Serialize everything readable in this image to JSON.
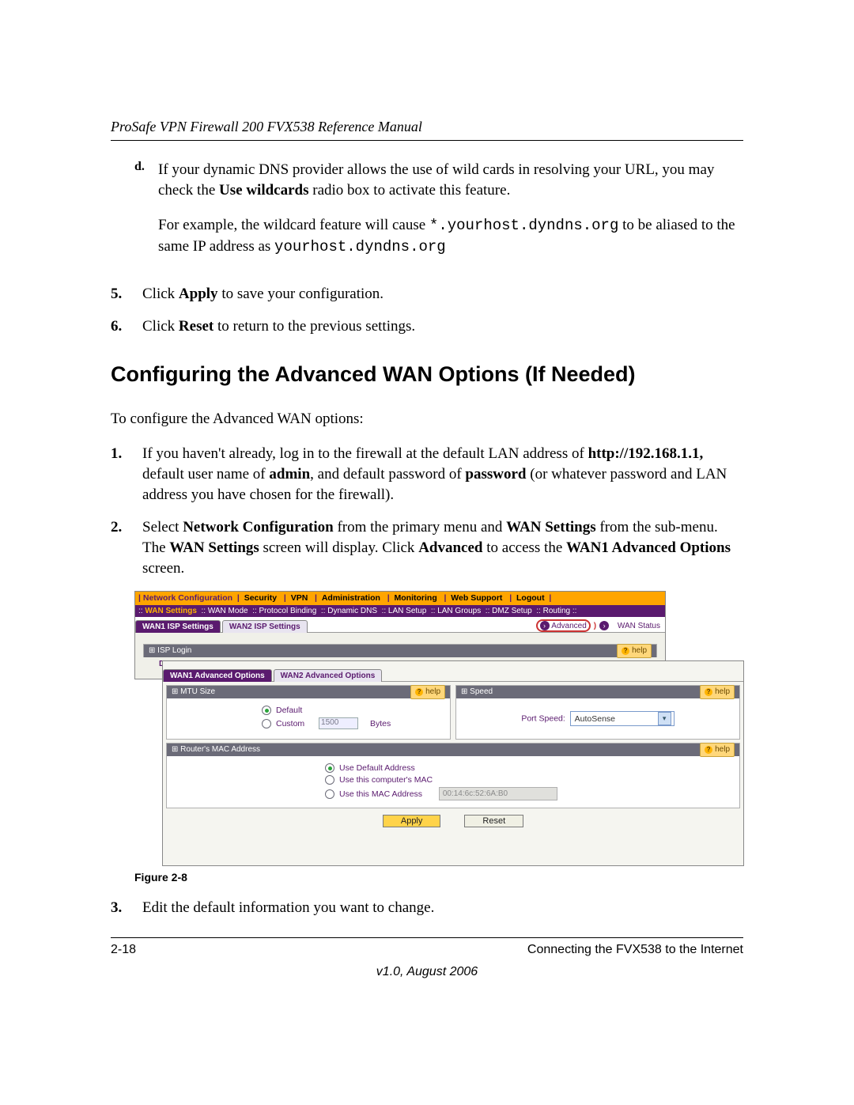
{
  "header": {
    "title": "ProSafe VPN Firewall 200 FVX538 Reference Manual"
  },
  "body": {
    "sub_d_lead": "d.",
    "sub_d_p1a": "If your dynamic DNS provider allows the use of wild cards in resolving your URL, you may check the ",
    "sub_d_p1_bold": "Use wildcards",
    "sub_d_p1b": " radio box to activate this feature.",
    "sub_d_p2a": "For example, the wildcard feature will cause ",
    "sub_d_p2_code1": "*.yourhost.dyndns.org",
    "sub_d_p2b": " to be aliased to the same IP address as ",
    "sub_d_p2_code2": "yourhost.dyndns.org",
    "step5_num": "5.",
    "step5a": "Click ",
    "step5_bold": "Apply",
    "step5b": " to save your configuration.",
    "step6_num": "6.",
    "step6a": "Click ",
    "step6_bold": "Reset",
    "step6b": " to return to the previous settings.",
    "h2": "Configuring the Advanced WAN Options (If Needed)",
    "intro": "To configure the Advanced WAN options:",
    "s1_num": "1.",
    "s1a": "If you haven't already, log in to the firewall at the default LAN address of ",
    "s1_b1": "http://192.168.1.1,",
    "s1b": " default user name of ",
    "s1_b2": "admin",
    "s1c": ", and default password of ",
    "s1_b3": "password",
    "s1d": " (or whatever password and LAN address you have chosen for the firewall).",
    "s2_num": "2.",
    "s2a": "Select ",
    "s2_b1": "Network Configuration",
    "s2b": " from the primary menu and ",
    "s2_b2": "WAN Settings",
    "s2c": " from the sub-menu. The ",
    "s2_b3": "WAN Settings",
    "s2d": " screen will display. Click ",
    "s2_b4": "Advanced",
    "s2e": " to access the ",
    "s2_b5": "WAN1 Advanced Options",
    "s2f": " screen.",
    "fig_caption": "Figure 2-8",
    "s3_num": "3.",
    "s3": "Edit the default information you want to change."
  },
  "router": {
    "primary_menu": [
      "Network Configuration",
      "Security",
      "VPN",
      "Administration",
      "Monitoring",
      "Web Support",
      "Logout"
    ],
    "submenu": [
      "WAN Settings",
      "WAN Mode",
      "Protocol Binding",
      "Dynamic DNS",
      "LAN Setup",
      "LAN Groups",
      "DMZ Setup",
      "Routing"
    ],
    "tabs_back": {
      "a": "WAN1 ISP Settings",
      "b": "WAN2 ISP Settings",
      "advanced": "Advanced",
      "wan_status": "WAN Status"
    },
    "back_section": "ISP Login",
    "back_doe": "Doe",
    "tabs_front": {
      "a": "WAN1 Advanced Options",
      "b": "WAN2 Advanced Options"
    },
    "mtu": {
      "title": "MTU Size",
      "opt_default": "Default",
      "opt_custom": "Custom",
      "value": "1500",
      "unit": "Bytes"
    },
    "speed": {
      "title": "Speed",
      "label": "Port Speed:",
      "value": "AutoSense"
    },
    "mac": {
      "title": "Router's MAC Address",
      "opt1": "Use Default Address",
      "opt2": "Use this computer's MAC",
      "opt3": "Use this MAC Address",
      "value": "00:14:6c:52:6A:B0"
    },
    "help": "help",
    "btn_apply": "Apply",
    "btn_reset": "Reset"
  },
  "footer": {
    "left": "2-18",
    "right": "Connecting the FVX538 to the Internet",
    "version": "v1.0, August 2006"
  }
}
